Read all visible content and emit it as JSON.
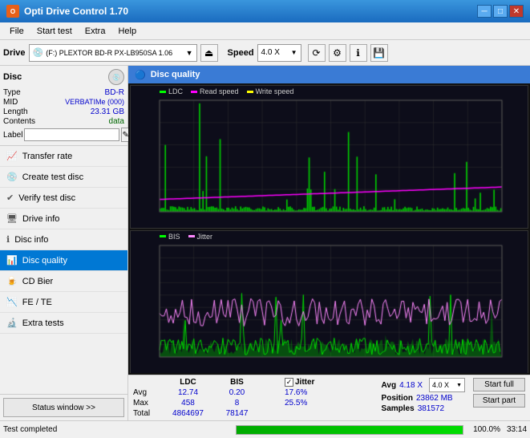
{
  "app": {
    "title": "Opti Drive Control 1.70",
    "icon_label": "O"
  },
  "menu": {
    "items": [
      "File",
      "Start test",
      "Extra",
      "Help"
    ]
  },
  "toolbar": {
    "drive_label": "Drive",
    "drive_value": "(F:) PLEXTOR BD-R  PX-LB950SA 1.06",
    "speed_label": "Speed",
    "speed_value": "4.0 X"
  },
  "sidebar": {
    "disc_title": "Disc",
    "disc_fields": [
      {
        "key": "Type",
        "val": "BD-R"
      },
      {
        "key": "MID",
        "val": "VERBATIMe (000)"
      },
      {
        "key": "Length",
        "val": "23.31 GB"
      },
      {
        "key": "Contents",
        "val": "data"
      },
      {
        "key": "Label",
        "val": ""
      }
    ],
    "nav_items": [
      {
        "label": "Transfer rate",
        "active": false
      },
      {
        "label": "Create test disc",
        "active": false
      },
      {
        "label": "Verify test disc",
        "active": false
      },
      {
        "label": "Drive info",
        "active": false
      },
      {
        "label": "Disc info",
        "active": false
      },
      {
        "label": "Disc quality",
        "active": true
      },
      {
        "label": "CD Bier",
        "active": false
      },
      {
        "label": "FE / TE",
        "active": false
      },
      {
        "label": "Extra tests",
        "active": false
      }
    ],
    "status_btn": "Status window >>"
  },
  "disc_quality": {
    "title": "Disc quality",
    "legend": {
      "ldc_label": "LDC",
      "ldc_color": "#00ff00",
      "read_label": "Read speed",
      "read_color": "#ff00ff",
      "write_label": "Write speed",
      "write_color": "#ffff00",
      "bis_label": "BIS",
      "bis_color": "#00ff00",
      "jitter_label": "Jitter",
      "jitter_color": "#ff88ff"
    },
    "chart1": {
      "y_labels_left": [
        "500",
        "400",
        "300",
        "200",
        "100",
        "0"
      ],
      "y_labels_right": [
        "18X",
        "16X",
        "14X",
        "12X",
        "10X",
        "8X",
        "6X",
        "4X",
        "2X"
      ],
      "x_labels": [
        "0.0",
        "2.5",
        "5.0",
        "7.5",
        "10.0",
        "12.5",
        "15.0",
        "17.5",
        "20.0",
        "22.5",
        "25.0 GB"
      ]
    },
    "chart2": {
      "y_labels_left": [
        "10",
        "9",
        "8",
        "7",
        "6",
        "5",
        "4",
        "3",
        "2",
        "1"
      ],
      "y_labels_right": [
        "40%",
        "32%",
        "24%",
        "16%",
        "8%"
      ],
      "x_labels": [
        "0.0",
        "2.5",
        "5.0",
        "7.5",
        "10.0",
        "12.5",
        "15.0",
        "17.5",
        "20.0",
        "22.5",
        "25.0 GB"
      ]
    }
  },
  "stats": {
    "columns": [
      "",
      "LDC",
      "BIS",
      "",
      "Jitter",
      "Speed",
      ""
    ],
    "avg_label": "Avg",
    "avg_ldc": "12.74",
    "avg_bis": "0.20",
    "avg_jitter": "17.6%",
    "avg_speed": "4.18 X",
    "avg_speed_select": "4.0 X",
    "max_label": "Max",
    "max_ldc": "458",
    "max_bis": "8",
    "max_jitter": "25.5%",
    "position_label": "Position",
    "position_val": "23862 MB",
    "total_label": "Total",
    "total_ldc": "4864697",
    "total_bis": "78147",
    "samples_label": "Samples",
    "samples_val": "381572",
    "jitter_checked": true,
    "start_full_btn": "Start full",
    "start_part_btn": "Start part"
  },
  "bottom_bar": {
    "status_text": "Test completed",
    "progress_pct": 100,
    "progress_label": "100.0%",
    "time_label": "33:14"
  }
}
